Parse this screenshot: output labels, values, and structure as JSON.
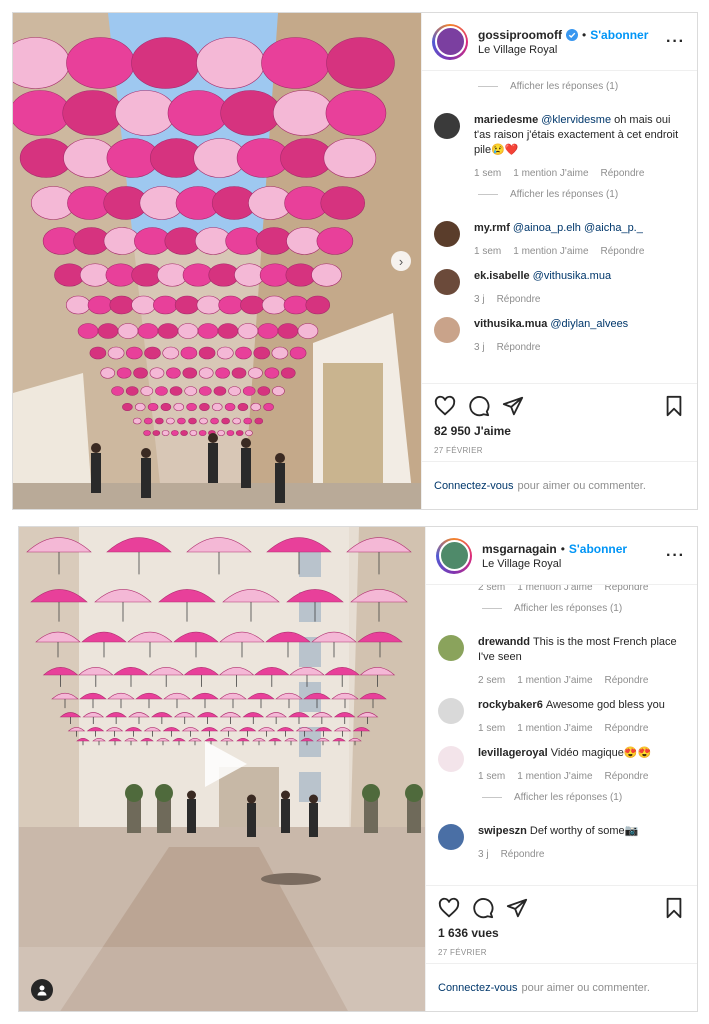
{
  "post1": {
    "username": "gossiproomoff",
    "follow_label": "S'abonner",
    "location": "Le Village Royal",
    "comments": [
      {
        "type": "replies",
        "label": "Afficher les réponses (1)"
      },
      {
        "type": "comment",
        "user": "mariedesme",
        "mention": "@klervidesme",
        "text": " oh mais oui t'as raison j'étais exactement à cet endroit pile",
        "emoji": "😢❤️",
        "time": "1 sem",
        "likes": "1 mention J'aime",
        "reply": "Répondre",
        "avatar_color": "#3a3a3a"
      },
      {
        "type": "replies",
        "label": "Afficher les réponses (1)"
      },
      {
        "type": "comment",
        "user": "my.rmf",
        "mention": "@ainoa_p.elh @aicha_p._",
        "text": "",
        "emoji": "",
        "time": "1 sem",
        "likes": "1 mention J'aime",
        "reply": "Répondre",
        "avatar_color": "#5a3d2b"
      },
      {
        "type": "comment",
        "user": "ek.isabelle",
        "mention": "@vithusika.mua",
        "text": "",
        "emoji": "",
        "time": "3 j",
        "likes": "",
        "reply": "Répondre",
        "avatar_color": "#6b4a3a"
      },
      {
        "type": "comment",
        "user": "vithusika.mua",
        "mention": "@diylan_alvees",
        "text": "",
        "emoji": "",
        "time": "3 j",
        "likes": "",
        "reply": "Répondre",
        "avatar_color": "#c9a38a"
      }
    ],
    "likes": "82 950 J'aime",
    "date": "27 février",
    "login_link": "Connectez-vous",
    "login_text": "pour aimer ou commenter."
  },
  "post2": {
    "username": "msgarnagain",
    "follow_label": "S'abonner",
    "location": "Le Village Royal",
    "top_meta": {
      "time": "2 sem",
      "likes": "1 mention J'aime",
      "reply": "Répondre"
    },
    "comments": [
      {
        "type": "replies",
        "label": "Afficher les réponses (1)"
      },
      {
        "type": "comment",
        "user": "drewandd",
        "mention": "",
        "text": "This is the most French place I've seen",
        "emoji": "",
        "time": "2 sem",
        "likes": "1 mention J'aime",
        "reply": "Répondre",
        "avatar_color": "#8aa35c"
      },
      {
        "type": "comment",
        "user": "rockybaker6",
        "mention": "",
        "text": "Awesome god bless you",
        "emoji": "",
        "time": "1 sem",
        "likes": "1 mention J'aime",
        "reply": "Répondre",
        "avatar_color": "#d9d9d9"
      },
      {
        "type": "comment",
        "user": "levillageroyal",
        "mention": "",
        "text": "Vidéo magique",
        "emoji": "😍😍",
        "time": "1 sem",
        "likes": "1 mention J'aime",
        "reply": "Répondre",
        "avatar_color": "#f3e4ea"
      },
      {
        "type": "replies",
        "label": "Afficher les réponses (1)"
      },
      {
        "type": "comment",
        "user": "swipeszn",
        "mention": "",
        "text": "Def worthy of some",
        "emoji": "📷",
        "time": "3 j",
        "likes": "",
        "reply": "Répondre",
        "avatar_color": "#4a6fa5"
      }
    ],
    "likes": "1 636 vues",
    "date": "27 février",
    "login_link": "Connectez-vous",
    "login_text": "pour aimer ou commenter."
  },
  "colors": {
    "accent": "#0095f6",
    "umbrella_pink": "#e8409a",
    "umbrella_light": "#f4b8d6",
    "sky": "#9ec8f0"
  }
}
